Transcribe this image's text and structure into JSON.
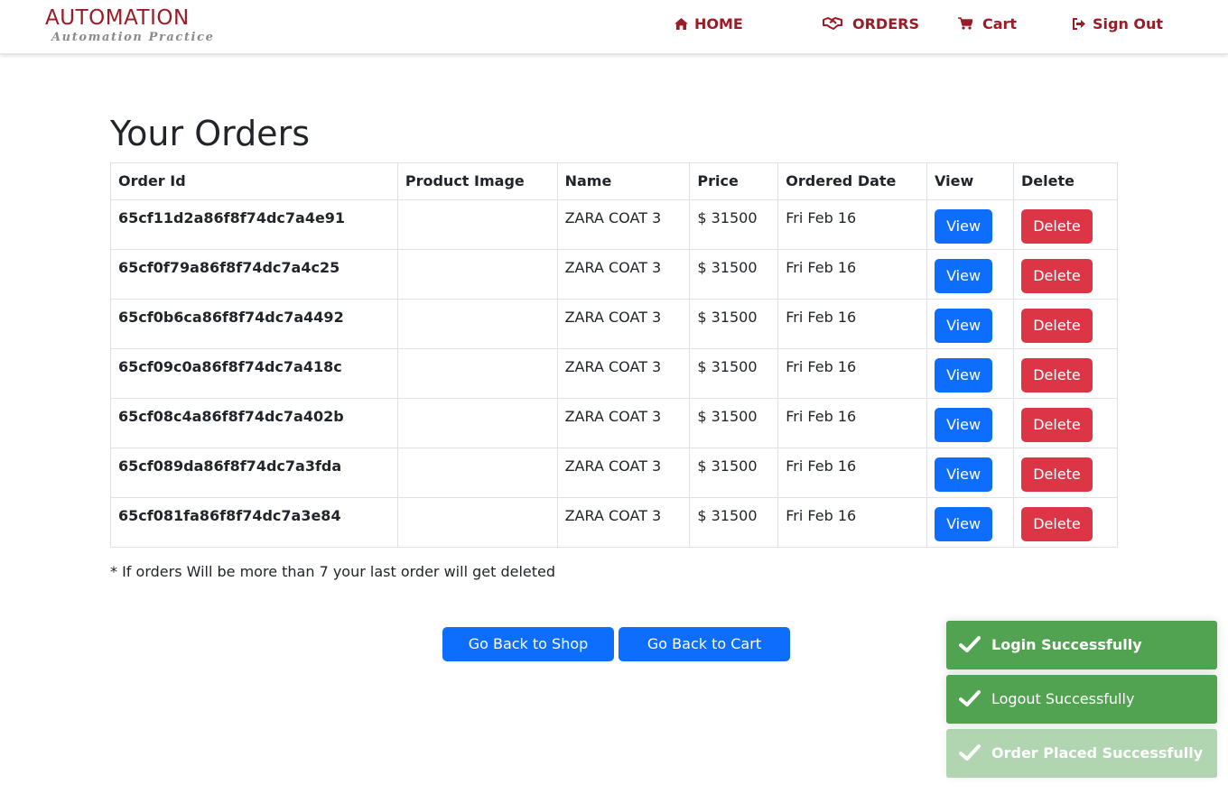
{
  "brand": {
    "title": "AUTOMATION",
    "subtitle": "Automation Practice",
    "color": "#9b1b26"
  },
  "nav": {
    "home": {
      "label": "HOME",
      "icon": "home-icon"
    },
    "orders": {
      "label": "ORDERS",
      "icon": "handshake-icon"
    },
    "cart": {
      "label": "Cart",
      "icon": "shopping-cart-icon"
    },
    "signout": {
      "label": "Sign Out",
      "icon": "sign-out-icon"
    }
  },
  "page": {
    "title": "Your Orders"
  },
  "table": {
    "headers": [
      "Order Id",
      "Product Image",
      "Name",
      "Price",
      "Ordered Date",
      "View",
      "Delete"
    ],
    "rows": [
      {
        "order_id": "65cf11d2a86f8f74dc7a4e91",
        "name": "ZARA COAT 3",
        "price": "$ 31500",
        "date": "Fri Feb 16",
        "view": "View",
        "delete": "Delete"
      },
      {
        "order_id": "65cf0f79a86f8f74dc7a4c25",
        "name": "ZARA COAT 3",
        "price": "$ 31500",
        "date": "Fri Feb 16",
        "view": "View",
        "delete": "Delete"
      },
      {
        "order_id": "65cf0b6ca86f8f74dc7a4492",
        "name": "ZARA COAT 3",
        "price": "$ 31500",
        "date": "Fri Feb 16",
        "view": "View",
        "delete": "Delete"
      },
      {
        "order_id": "65cf09c0a86f8f74dc7a418c",
        "name": "ZARA COAT 3",
        "price": "$ 31500",
        "date": "Fri Feb 16",
        "view": "View",
        "delete": "Delete"
      },
      {
        "order_id": "65cf08c4a86f8f74dc7a402b",
        "name": "ZARA COAT 3",
        "price": "$ 31500",
        "date": "Fri Feb 16",
        "view": "View",
        "delete": "Delete"
      },
      {
        "order_id": "65cf089da86f8f74dc7a3fda",
        "name": "ZARA COAT 3",
        "price": "$ 31500",
        "date": "Fri Feb 16",
        "view": "View",
        "delete": "Delete"
      },
      {
        "order_id": "65cf081fa86f8f74dc7a3e84",
        "name": "ZARA COAT 3",
        "price": "$ 31500",
        "date": "Fri Feb 16",
        "view": "View",
        "delete": "Delete"
      }
    ]
  },
  "note": "* If orders Will be more than 7 your last order will get deleted",
  "actions": {
    "back_to_shop": "Go Back to Shop",
    "back_to_cart": "Go Back to Cart"
  },
  "toasts": [
    {
      "message": "Login Successfully",
      "icon": "check-icon"
    },
    {
      "message": "Logout Successfully",
      "icon": "check-icon"
    },
    {
      "message": "Order Placed Successfully",
      "icon": "check-icon"
    }
  ],
  "colors": {
    "primary": "#0d6efd",
    "danger": "#dc3545",
    "success": "#51a351",
    "brand": "#9b1b26"
  }
}
